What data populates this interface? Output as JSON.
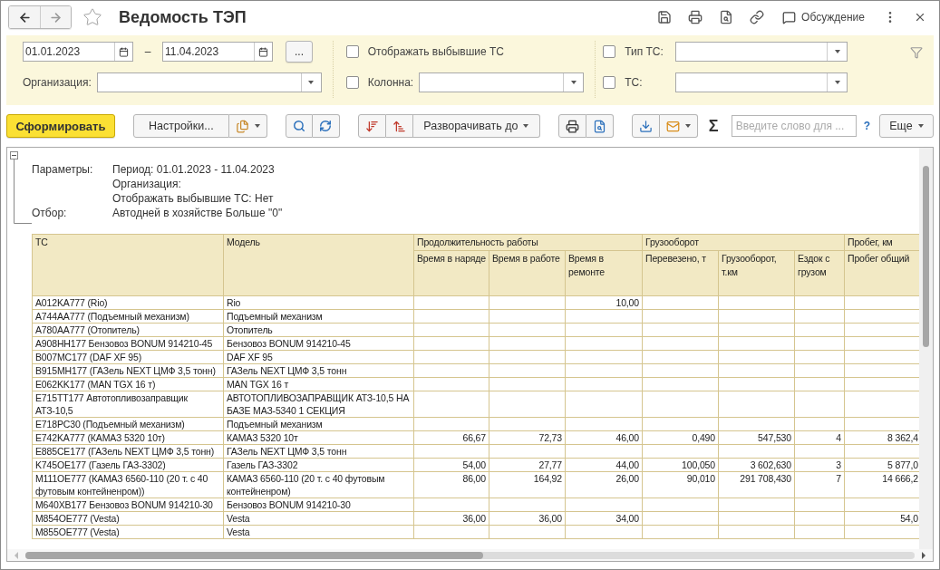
{
  "window": {
    "title": "Ведомость ТЭП",
    "discussion": "Обсуждение"
  },
  "filters": {
    "period_start": "01.01.2023",
    "period_separator": "–",
    "period_end": "11.04.2023",
    "period_button": "...",
    "organization": {
      "label": "Организация:"
    },
    "show_retired": {
      "label": "Отображать выбывшие ТС",
      "checked": false
    },
    "column": {
      "label": "Колонна:",
      "checked": false
    },
    "vehicle_type": {
      "label": "Тип ТС:",
      "checked": false
    },
    "vehicle": {
      "label": "ТС:",
      "checked": false
    }
  },
  "toolbar": {
    "generate": "Сформировать",
    "settings": "Настройки...",
    "expand_to": "Разворачивать до",
    "sum": "Σ",
    "search_placeholder": "Введите слово для ...",
    "help": "?",
    "more": "Еще"
  },
  "report": {
    "expanded": true,
    "parameters": [
      {
        "label": "Параметры:",
        "lines": [
          "Период: 01.01.2023 - 11.04.2023",
          "Организация:",
          "Отображать выбывшие ТС: Нет"
        ]
      },
      {
        "label": "Отбор:",
        "lines": [
          "Автодней в хозяйстве Больше \"0\""
        ]
      }
    ],
    "table": {
      "columns": [
        {
          "label": "ТС"
        },
        {
          "label": "Модель"
        },
        {
          "label": "Продолжительность работы",
          "children": [
            "Время в наряде",
            "Время в работе",
            "Время в ремонте"
          ]
        },
        {
          "label": "Грузооборот",
          "children": [
            "Перевезено, т",
            "Грузооборот, т.км",
            "Ездок с грузом"
          ]
        },
        {
          "label": "Пробег, км",
          "children": [
            "Пробег общий"
          ]
        }
      ],
      "rows": [
        {
          "ts": "A012KA777 (Rio)",
          "model": "Rio",
          "in_repair": "10,00"
        },
        {
          "ts": "A744AA777 (Подъемный механизм)",
          "model": "Подъемный механизм"
        },
        {
          "ts": "A780AA777 (Отопитель)",
          "model": "Отопитель"
        },
        {
          "ts": "A908HH177 Бензовоз BONUM 914210-45",
          "model": "Бензовоз BONUM 914210-45"
        },
        {
          "ts": "B007MC177 (DAF XF 95)",
          "model": "DAF XF 95"
        },
        {
          "ts": "B915MH177 (ГАЗель NEXT ЦМФ 3,5 тонн)",
          "model": "ГАЗель NEXT ЦМФ 3,5 тонн"
        },
        {
          "ts": "E062KK177 (MAN TGX 16 т)",
          "model": "MAN TGX 16 т"
        },
        {
          "ts": "E715TT177 Автотопливозаправщик АТЗ-10,5",
          "model": "АВТОТОПЛИВОЗАПРАВЩИК АТЗ-10,5 НА БАЗЕ МАЗ-5340 1 СЕКЦИЯ"
        },
        {
          "ts": "E718PC30 (Подъемный механизм)",
          "model": "Подъемный механизм"
        },
        {
          "ts": "E742KA777 (КАМАЗ 5320 10т)",
          "model": "КАМАЗ 5320 10т",
          "on_order": "66,67",
          "at_work": "72,73",
          "in_repair": "46,00",
          "carried": "0,490",
          "turnover": "547,530",
          "trips": "4",
          "mileage": "8 362,4"
        },
        {
          "ts": "E885CE177 (ГАЗель NEXT ЦМФ 3,5 тонн)",
          "model": "ГАЗель NEXT ЦМФ 3,5 тонн"
        },
        {
          "ts": "K745OE177 (Газель ГАЗ-3302)",
          "model": "Газель ГАЗ-3302",
          "on_order": "54,00",
          "at_work": "27,77",
          "in_repair": "44,00",
          "carried": "100,050",
          "turnover": "3 602,630",
          "trips": "3",
          "mileage": "5 877,0"
        },
        {
          "ts": "M111OE777 (КАМАЗ 6560-110 (20 т. с 40 футовым контейненром))",
          "model": "КАМАЗ 6560-110 (20 т. с 40 футовым контейненром)",
          "on_order": "86,00",
          "at_work": "164,92",
          "in_repair": "26,00",
          "carried": "90,010",
          "turnover": "291 708,430",
          "trips": "7",
          "mileage": "14 666,2"
        },
        {
          "ts": "M640XB177 Бензовоз BONUM 914210-30",
          "model": "Бензовоз BONUM 914210-30"
        },
        {
          "ts": "M854OE777 (Vesta)",
          "model": "Vesta",
          "on_order": "36,00",
          "at_work": "36,00",
          "in_repair": "34,00",
          "mileage": "54,0"
        },
        {
          "ts": "M855OE777 (Vesta)",
          "model": "Vesta"
        }
      ]
    }
  }
}
